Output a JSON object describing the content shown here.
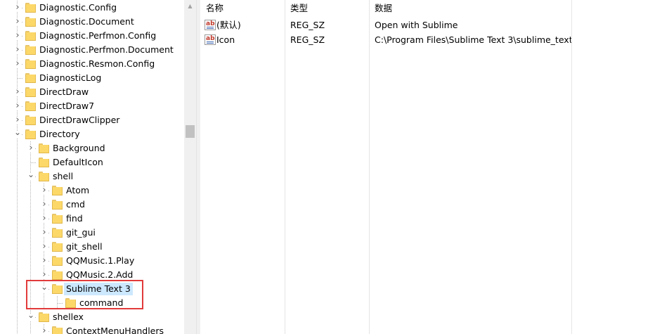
{
  "tree": {
    "items": [
      {
        "label": "Diagnostic.Config",
        "level": 0,
        "expander": "collapsed"
      },
      {
        "label": "Diagnostic.Document",
        "level": 0,
        "expander": "collapsed"
      },
      {
        "label": "Diagnostic.Perfmon.Config",
        "level": 0,
        "expander": "collapsed"
      },
      {
        "label": "Diagnostic.Perfmon.Document",
        "level": 0,
        "expander": "collapsed"
      },
      {
        "label": "Diagnostic.Resmon.Config",
        "level": 0,
        "expander": "collapsed"
      },
      {
        "label": "DiagnosticLog",
        "level": 0,
        "expander": "none"
      },
      {
        "label": "DirectDraw",
        "level": 0,
        "expander": "collapsed"
      },
      {
        "label": "DirectDraw7",
        "level": 0,
        "expander": "collapsed"
      },
      {
        "label": "DirectDrawClipper",
        "level": 0,
        "expander": "collapsed"
      },
      {
        "label": "Directory",
        "level": 0,
        "expander": "expanded"
      },
      {
        "label": "Background",
        "level": 1,
        "expander": "collapsed"
      },
      {
        "label": "DefaultIcon",
        "level": 1,
        "expander": "none"
      },
      {
        "label": "shell",
        "level": 1,
        "expander": "expanded"
      },
      {
        "label": "Atom",
        "level": 2,
        "expander": "collapsed"
      },
      {
        "label": "cmd",
        "level": 2,
        "expander": "collapsed"
      },
      {
        "label": "find",
        "level": 2,
        "expander": "collapsed"
      },
      {
        "label": "git_gui",
        "level": 2,
        "expander": "collapsed"
      },
      {
        "label": "git_shell",
        "level": 2,
        "expander": "collapsed"
      },
      {
        "label": "QQMusic.1.Play",
        "level": 2,
        "expander": "collapsed"
      },
      {
        "label": "QQMusic.2.Add",
        "level": 2,
        "expander": "collapsed"
      },
      {
        "label": "Sublime Text 3",
        "level": 2,
        "expander": "expanded",
        "selected": true
      },
      {
        "label": "command",
        "level": 3,
        "expander": "none"
      },
      {
        "label": "shellex",
        "level": 1,
        "expander": "expanded"
      },
      {
        "label": "ContextMenuHandlers",
        "level": 2,
        "expander": "collapsed"
      }
    ]
  },
  "list": {
    "columns": {
      "name": "名称",
      "type": "类型",
      "data": "数据"
    },
    "rows": [
      {
        "name": "(默认)",
        "type": "REG_SZ",
        "data": "Open with Sublime",
        "icon": "string-value-icon"
      },
      {
        "name": "Icon",
        "type": "REG_SZ",
        "data": "C:\\Program Files\\Sublime Text 3\\sublime_text....",
        "icon": "string-value-icon"
      }
    ]
  },
  "colors": {
    "selection": "#cce8ff",
    "highlight_box": "#e23b3b",
    "folder": "#fcd869"
  }
}
